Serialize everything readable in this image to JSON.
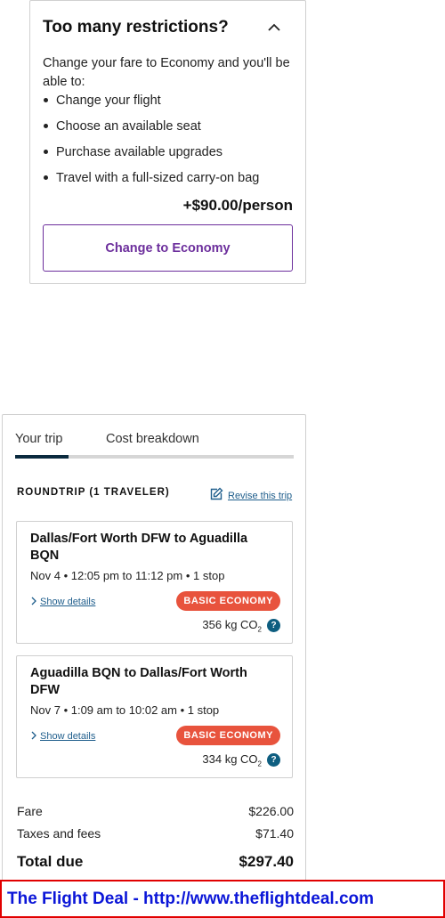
{
  "restrictions": {
    "title": "Too many restrictions?",
    "intro": "Change your fare to Economy and you'll be able to:",
    "benefits": [
      "Change your flight",
      "Choose an available seat",
      "Purchase available upgrades",
      "Travel with a full-sized carry-on bag"
    ],
    "price": "+$90.00/person",
    "button_label": "Change to Economy",
    "collapse_icon": "chevron-up-icon",
    "accent_color": "#6c2e9c"
  },
  "trip": {
    "tabs": [
      "Your trip",
      "Cost breakdown"
    ],
    "active_tab": "Your trip",
    "heading": "ROUNDTRIP (1 TRAVELER)",
    "revise_label": "Revise this trip",
    "revise_icon": "edit-icon",
    "flights": [
      {
        "route": "Dallas/Fort Worth DFW to Aguadilla BQN",
        "times": "Nov 4 • 12:05 pm to 11:12 pm • 1 stop",
        "details_label": "Show details",
        "fare_badge": "BASIC ECONOMY",
        "co2_value": "356 kg CO",
        "co2_sub": "2"
      },
      {
        "route": "Aguadilla BQN to Dallas/Fort Worth DFW",
        "times": "Nov 7 • 1:09 am to 10:02 am • 1 stop",
        "details_label": "Show details",
        "fare_badge": "BASIC ECONOMY",
        "co2_value": "334 kg CO",
        "co2_sub": "2"
      }
    ],
    "help_icon_glyph": "?",
    "fare_label": "Fare",
    "fare_value": "$226.00",
    "taxes_label": "Taxes and fees",
    "taxes_value": "$71.40",
    "total_label": "Total due",
    "total_value": "$297.40",
    "badge_color": "#e8533d"
  },
  "watermark": {
    "text": "The Flight Deal - http://www.theflightdeal.com"
  }
}
